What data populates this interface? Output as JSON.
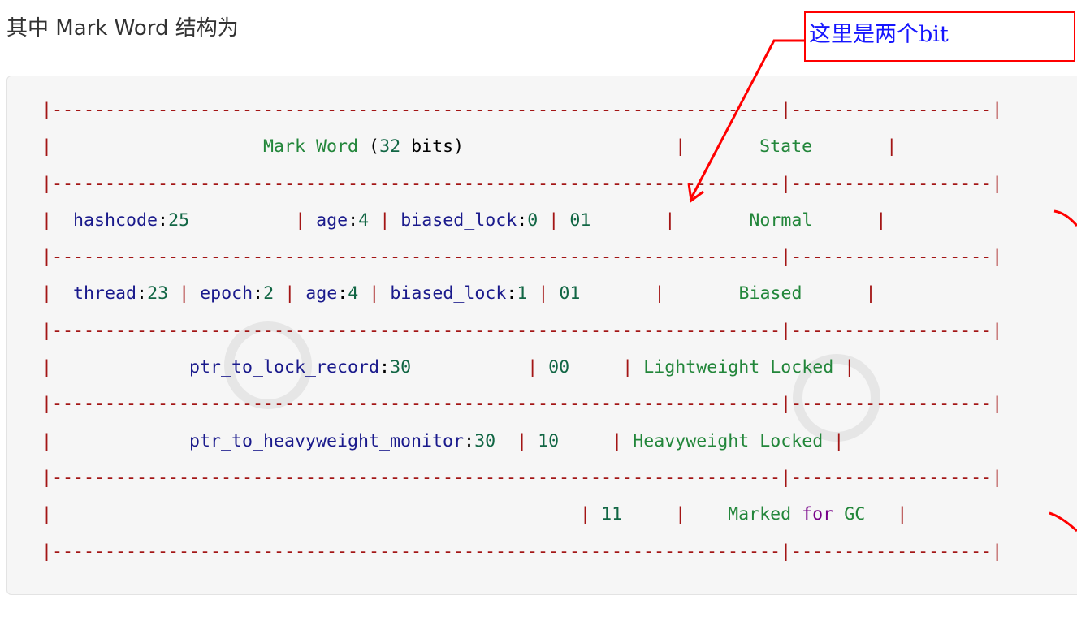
{
  "heading": "其中 Mark Word 结构为",
  "annotation": {
    "text": "这里是两个bit",
    "color": "#1515ff",
    "border_color": "#ff0000"
  },
  "code_block": {
    "border_char": "|",
    "separator_left": "---------------------------------------------------------------------",
    "separator_right": "-------------------",
    "header": {
      "pre": "           ",
      "mark_word": "Mark Word",
      "bits_open": " (",
      "bits_num": "32",
      "bits_label": " bits",
      "bits_close": ")",
      "state": "State"
    },
    "normal": {
      "hash_key": "hashcode",
      "hash_val": "25",
      "age_key": "age",
      "age_val": "4",
      "biased_key": "biased_lock",
      "biased_val": "0",
      "lock_bits": "01",
      "state": "Normal"
    },
    "biased": {
      "thread_key": "thread",
      "thread_val": "23",
      "epoch_key": "epoch",
      "epoch_val": "2",
      "age_key": "age",
      "age_val": "4",
      "biased_key": "biased_lock",
      "biased_val": "1",
      "lock_bits": "01",
      "state": "Biased"
    },
    "lightweight": {
      "ptr_key": "ptr_to_lock_record",
      "ptr_val": "30",
      "lock_bits": "00",
      "state": "Lightweight Locked"
    },
    "heavyweight": {
      "ptr_key": "ptr_to_heavyweight_monitor",
      "ptr_val": "30",
      "lock_bits": "10",
      "state": "Heavyweight Locked"
    },
    "gc": {
      "lock_bits": "11",
      "state_a": "Marked",
      "state_for": "for",
      "state_b": "GC"
    }
  },
  "colors": {
    "border": "#a31515",
    "text": "#22863a",
    "field": "#1a1a8c",
    "number": "#116644",
    "keyword": "#770088",
    "annotation_stroke": "#ff0000"
  }
}
